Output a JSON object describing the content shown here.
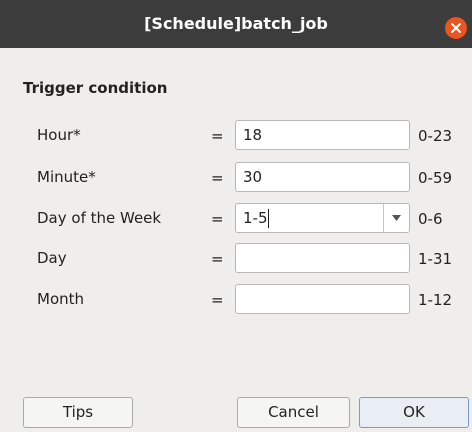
{
  "window": {
    "title": "[Schedule]batch_job",
    "close_icon": "close-icon",
    "accent_color": "#e95420"
  },
  "section": {
    "title": "Trigger condition"
  },
  "fields": [
    {
      "label": "Hour*",
      "eq": "=",
      "value": "18",
      "range": "0-23"
    },
    {
      "label": "Minute*",
      "eq": "=",
      "value": "30",
      "range": "0-59"
    },
    {
      "label": "Day of the Week",
      "eq": "=",
      "value": "1-5",
      "range": "0-6"
    },
    {
      "label": "Day",
      "eq": "=",
      "value": "",
      "range": "1-31"
    },
    {
      "label": "Month",
      "eq": "=",
      "value": "",
      "range": "1-12"
    }
  ],
  "buttons": {
    "tips": "Tips",
    "cancel": "Cancel",
    "ok": "OK"
  }
}
